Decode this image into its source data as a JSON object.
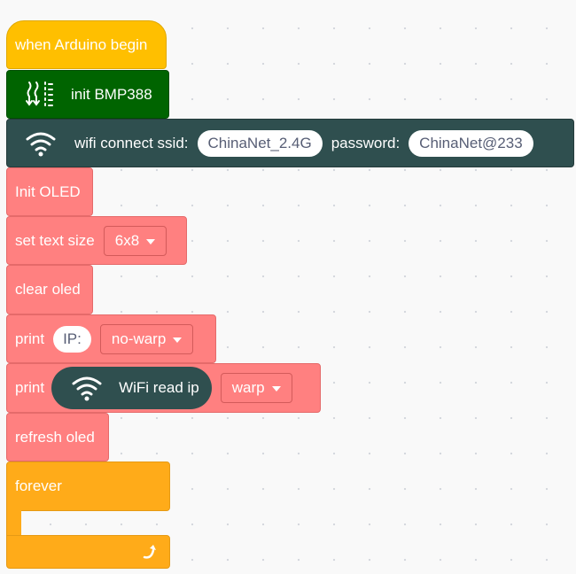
{
  "blocks": {
    "hat": {
      "label": "when Arduino begin"
    },
    "bmp": {
      "label": "init BMP388",
      "icon": "sensor-icon"
    },
    "wifi": {
      "label": "wifi connect ssid:",
      "ssid": "ChinaNet_2.4G",
      "password_label": "password:",
      "password": "ChinaNet@233",
      "icon": "wifi-icon"
    },
    "init_oled": {
      "label": "Init OLED"
    },
    "text_size": {
      "label": "set text size",
      "value": "6x8"
    },
    "clear_oled": {
      "label": "clear oled"
    },
    "print1": {
      "label": "print",
      "text": "IP:",
      "mode": "no-warp"
    },
    "print2": {
      "label": "print",
      "reporter_label": "WiFi read ip",
      "mode": "warp",
      "icon": "wifi-icon"
    },
    "refresh_oled": {
      "label": "refresh oled"
    },
    "forever": {
      "label": "forever",
      "icon": "loop-arrow-icon"
    }
  },
  "colors": {
    "events": "#ffbf00",
    "sensor": "#006400",
    "wifi": "#2f4f4f",
    "oled": "#ff8080",
    "control": "#ffab19"
  }
}
